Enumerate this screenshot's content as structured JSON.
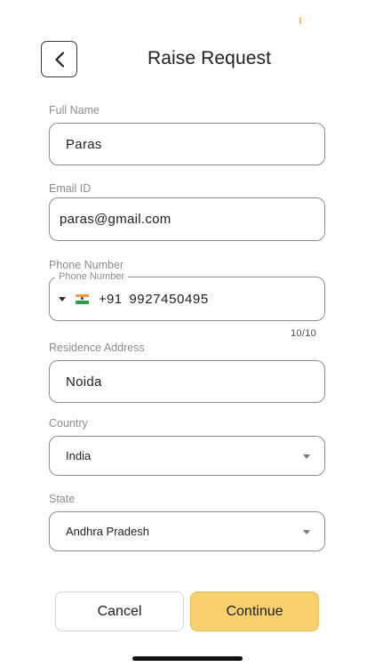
{
  "header": {
    "title": "Raise Request"
  },
  "form": {
    "full_name": {
      "label": "Full Name",
      "value": "Paras"
    },
    "email": {
      "label": "Email ID",
      "value": "paras@gmail.com"
    },
    "phone": {
      "label": "Phone Number",
      "inner_label": "Phone Number",
      "country_flag": "india-flag",
      "dial_code": "+91",
      "number": "9927450495",
      "counter": "10/10"
    },
    "address": {
      "label": "Residence Address",
      "value": "Noida"
    },
    "country": {
      "label": "Country",
      "selected": "India"
    },
    "state": {
      "label": "State",
      "selected": "Andhra Pradesh"
    }
  },
  "actions": {
    "cancel_label": "Cancel",
    "continue_label": "Continue"
  },
  "colors": {
    "accent": "#f8d06e",
    "border": "#8e8e8e",
    "label": "#8c8c8c"
  }
}
